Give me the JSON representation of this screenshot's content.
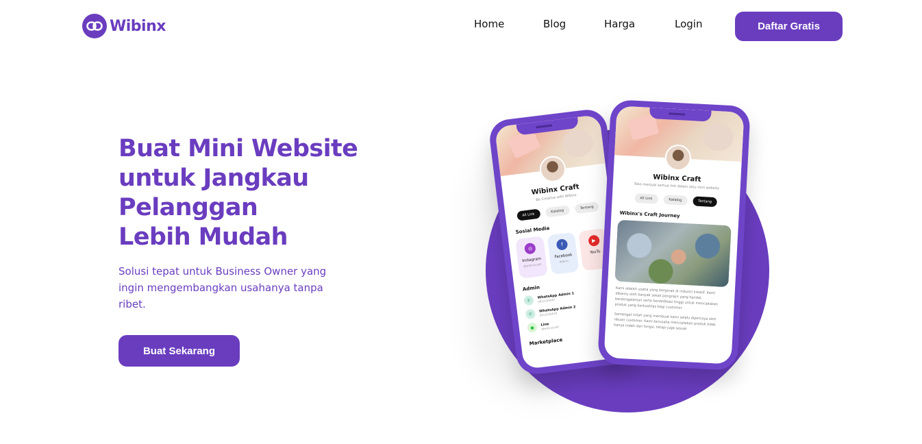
{
  "brand": {
    "name": "Wibinx",
    "color": "#6a3dbf"
  },
  "nav": {
    "links": [
      "Home",
      "Blog",
      "Harga",
      "Login"
    ],
    "cta": "Daftar Gratis"
  },
  "hero": {
    "title_lines": [
      "Buat Mini Website",
      "untuk Jangkau",
      "Pelanggan",
      "Lebih Mudah"
    ],
    "subtitle": "Solusi tepat untuk Business Owner yang ingin mengembangkan usahanya tanpa ribet.",
    "cta": "Buat Sekarang"
  },
  "phone_back": {
    "profile_name": "Wibinx Craft",
    "tagline": "Be Creative with Wibinx",
    "tabs": [
      "All Link",
      "Katalog",
      "Tentang"
    ],
    "active_tab": "All Link",
    "section_social": "Sosial Media",
    "social_cards": [
      {
        "label": "Instagram",
        "sub": "@wibinxcraft",
        "icon": "instagram-icon"
      },
      {
        "label": "Facebook",
        "sub": "Wibinx",
        "icon": "facebook-icon"
      },
      {
        "label": "YouTu",
        "sub": "",
        "icon": "youtube-icon"
      }
    ],
    "section_admin": "Admin",
    "admin": [
      {
        "title": "WhatsApp Admin 1",
        "sub": "0812345667",
        "icon": "whatsapp-icon"
      },
      {
        "title": "WhatsApp Admin 2",
        "sub": "0812345678",
        "icon": "whatsapp-icon"
      },
      {
        "title": "Line",
        "sub": "@wibinxcraft",
        "icon": "line-icon"
      }
    ],
    "section_marketplace": "Marketplace"
  },
  "phone_front": {
    "profile_name": "Wibinx Craft",
    "tagline": "Toko menjual semua link dalam satu mini website",
    "tabs": [
      "All Link",
      "Katalog",
      "Tentang"
    ],
    "active_tab": "Tentang",
    "section_title": "Wibinx's Craft Journey",
    "paragraph1": "Kami adalah usaha yang bergerak di industri kreatif. Kami dibantu oleh banyak sekali pengrajin yang handal, berpengalaman serta berdedikasi tinggi untuk menciptakan produk yang berkualitas bagi customer.",
    "paragraph2": "Semangat inilah yang membuat kami selalu dipercaya oleh ribuan customer. Kami berusaha menciptakan produk tidak hanya indah dan fungsi, tetapi juga sesuai"
  }
}
